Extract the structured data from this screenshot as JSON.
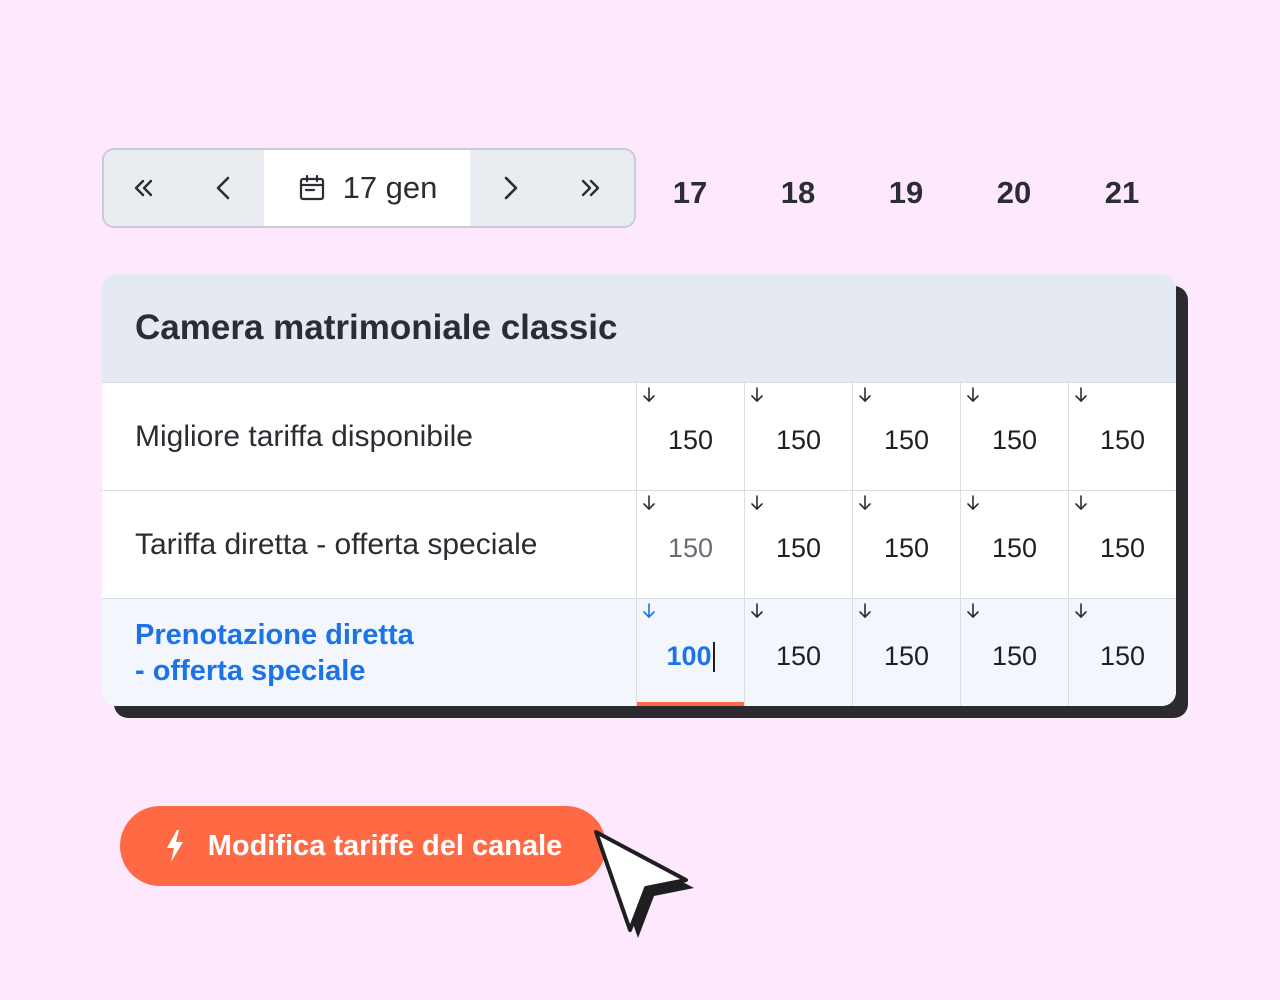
{
  "navigator": {
    "date_label": "17 gen",
    "icons": [
      "double-chevron-left-icon",
      "chevron-left-icon",
      "calendar-icon",
      "chevron-right-icon",
      "double-chevron-right-icon"
    ]
  },
  "days": [
    "17",
    "18",
    "19",
    "20",
    "21"
  ],
  "room": {
    "title": "Camera matrimoniale classic",
    "rows": [
      {
        "label": "Migliore tariffa disponibile",
        "values": [
          "150",
          "150",
          "150",
          "150",
          "150"
        ]
      },
      {
        "label": "Tariffa diretta - offerta speciale",
        "values": [
          "150",
          "150",
          "150",
          "150",
          "150"
        ]
      },
      {
        "label": "Prenotazione diretta\n- offerta speciale",
        "values": [
          "100",
          "150",
          "150",
          "150",
          "150"
        ]
      }
    ]
  },
  "cta": {
    "label": "Modifica tariffe del canale",
    "icon": "lightning-icon"
  },
  "colors": {
    "background": "#fde8fd",
    "accent": "#ff6a45",
    "link": "#1a73e8",
    "header": "#e5e9f1"
  }
}
